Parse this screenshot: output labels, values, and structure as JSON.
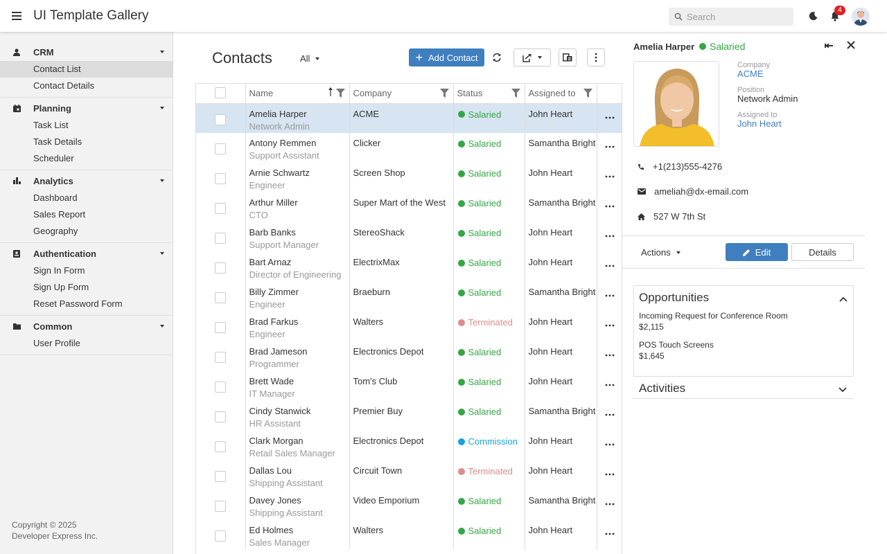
{
  "app": {
    "title": "UI Template Gallery",
    "search_placeholder": "Search",
    "notification_count": "4"
  },
  "sidebar": {
    "groups": [
      {
        "label": "CRM",
        "icon": "person-icon",
        "items": [
          "Contact List",
          "Contact Details"
        ],
        "active": "Contact List"
      },
      {
        "label": "Planning",
        "icon": "calendar-icon",
        "items": [
          "Task List",
          "Task Details",
          "Scheduler"
        ]
      },
      {
        "label": "Analytics",
        "icon": "bar-chart-icon",
        "items": [
          "Dashboard",
          "Sales Report",
          "Geography"
        ]
      },
      {
        "label": "Authentication",
        "icon": "id-card-icon",
        "items": [
          "Sign In Form",
          "Sign Up Form",
          "Reset Password Form"
        ]
      },
      {
        "label": "Common",
        "icon": "folder-icon",
        "items": [
          "User Profile"
        ]
      }
    ],
    "copyright_line1": "Copyright © 2025",
    "copyright_line2": "Developer Express Inc."
  },
  "main": {
    "title": "Contacts",
    "filter": "All",
    "add_button": "Add Contact"
  },
  "grid": {
    "columns": [
      "Name",
      "Company",
      "Status",
      "Assigned to"
    ],
    "rows": [
      {
        "name": "Amelia Harper",
        "position": "Network Admin",
        "company": "ACME",
        "status": "Salaried",
        "assigned": "John Heart"
      },
      {
        "name": "Antony Remmen",
        "position": "Support Assistant",
        "company": "Clicker",
        "status": "Salaried",
        "assigned": "Samantha Bright"
      },
      {
        "name": "Arnie Schwartz",
        "position": "Engineer",
        "company": "Screen Shop",
        "status": "Salaried",
        "assigned": "John Heart"
      },
      {
        "name": "Arthur Miller",
        "position": "CTO",
        "company": "Super Mart of the West",
        "status": "Salaried",
        "assigned": "Samantha Bright"
      },
      {
        "name": "Barb Banks",
        "position": "Support Manager",
        "company": "StereoShack",
        "status": "Salaried",
        "assigned": "John Heart"
      },
      {
        "name": "Bart Arnaz",
        "position": "Director of Engineering",
        "company": "ElectrixMax",
        "status": "Salaried",
        "assigned": "John Heart"
      },
      {
        "name": "Billy Zimmer",
        "position": "Engineer",
        "company": "Braeburn",
        "status": "Salaried",
        "assigned": "Samantha Bright"
      },
      {
        "name": "Brad Farkus",
        "position": "Engineer",
        "company": "Walters",
        "status": "Terminated",
        "assigned": "John Heart"
      },
      {
        "name": "Brad Jameson",
        "position": "Programmer",
        "company": "Electronics Depot",
        "status": "Salaried",
        "assigned": "John Heart"
      },
      {
        "name": "Brett Wade",
        "position": "IT Manager",
        "company": "Tom's Club",
        "status": "Salaried",
        "assigned": "John Heart"
      },
      {
        "name": "Cindy Stanwick",
        "position": "HR Assistant",
        "company": "Premier Buy",
        "status": "Salaried",
        "assigned": "Samantha Bright"
      },
      {
        "name": "Clark Morgan",
        "position": "Retail Sales Manager",
        "company": "Electronics Depot",
        "status": "Commission",
        "assigned": "John Heart"
      },
      {
        "name": "Dallas Lou",
        "position": "Shipping Assistant",
        "company": "Circuit Town",
        "status": "Terminated",
        "assigned": "John Heart"
      },
      {
        "name": "Davey Jones",
        "position": "Shipping Assistant",
        "company": "Video Emporium",
        "status": "Salaried",
        "assigned": "Samantha Bright"
      },
      {
        "name": "Ed Holmes",
        "position": "Sales Manager",
        "company": "Walters",
        "status": "Salaried",
        "assigned": "John Heart"
      }
    ]
  },
  "status_colors": {
    "Salaried": "#31a843",
    "Terminated": "#e08a8a",
    "Commission": "#1aa3de"
  },
  "panel": {
    "name": "Amelia Harper",
    "status": "Salaried",
    "company_label": "Company",
    "company": "ACME",
    "position_label": "Position",
    "position": "Network Admin",
    "assigned_label": "Assigned to",
    "assigned": "John Heart",
    "phone": "+1(213)555-4276",
    "email": "ameliah@dx-email.com",
    "address": "527 W 7th St",
    "actions_label": "Actions",
    "edit_label": "Edit",
    "details_label": "Details",
    "opportunities_title": "Opportunities",
    "opportunities": [
      {
        "title": "Incoming Request for Conference Room",
        "amount": "$2,115"
      },
      {
        "title": "POS Touch Screens",
        "amount": "$1,645"
      }
    ],
    "activities_title": "Activities"
  },
  "colors": {
    "accent": "#3f7fc0",
    "selected_row": "#d7e4f1",
    "sidebar_bg": "#f2f2f2"
  }
}
